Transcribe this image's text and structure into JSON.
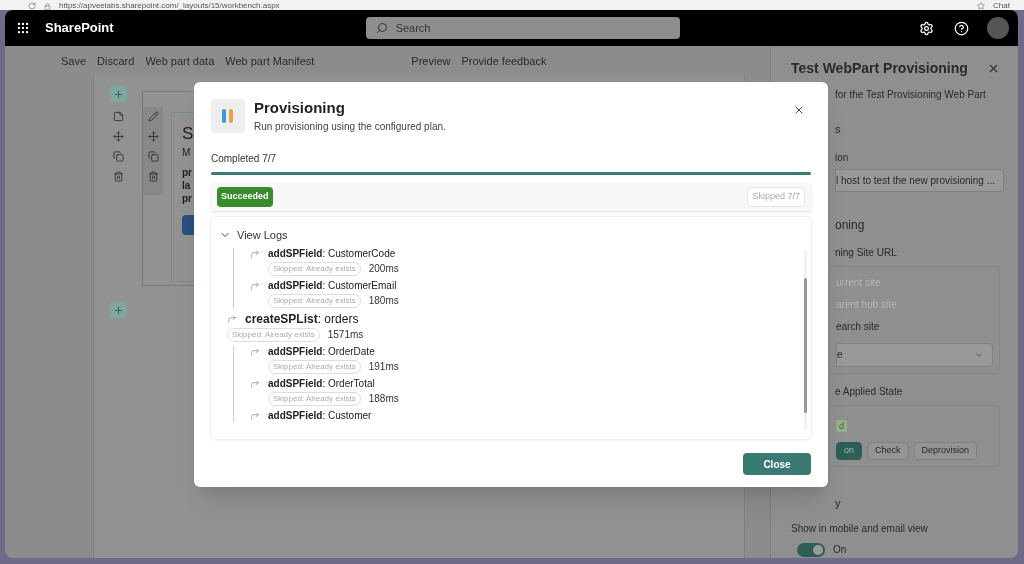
{
  "browser": {
    "url": "https://apveelabs.sharepoint.com/_layouts/15/workbench.aspx",
    "chat_label": "Chat"
  },
  "suite_bar": {
    "app_name": "SharePoint",
    "search_placeholder": "Search"
  },
  "command_bar": {
    "left": [
      "Save",
      "Discard",
      "Web part data",
      "Web part Manifest"
    ],
    "right": [
      "Preview",
      "Provide feedback"
    ]
  },
  "canvas": {
    "webpart_fragments": [
      "S",
      "M"
    ],
    "body_fragments": [
      "pr",
      "la",
      "pr"
    ]
  },
  "property_pane": {
    "title": "Test WebPart Provisioning",
    "description": "for the Test Provisioning Web Part",
    "group_1": "s",
    "field_label": "ion",
    "field_value": "l host to test the new provisioning ...",
    "group_2": "oning",
    "site_url_label": "ning Site URL",
    "site_options": [
      {
        "label": "urrent site",
        "disabled": true
      },
      {
        "label": "arent hub site",
        "disabled": true
      },
      {
        "label": "earch site",
        "disabled": false
      }
    ],
    "dropdown_value": "e",
    "state_label": "e Applied State",
    "state_badge": "d",
    "actions": [
      {
        "label": "on",
        "primary": true
      },
      {
        "label": "Check",
        "primary": false
      },
      {
        "label": "Deprovision",
        "primary": false
      }
    ],
    "group_3": "y",
    "toggle": {
      "label": "Show in mobile and email view",
      "on": true,
      "state_text": "On"
    }
  },
  "dialog": {
    "title": "Provisioning",
    "subtitle": "Run provisioning using the configured plan.",
    "progress_label": "Completed 7/7",
    "progress": {
      "level": 1
    },
    "result_badge": "Succeeded",
    "skipped_badge": "Skipped 7/7",
    "logs_header": "View Logs",
    "logs_expanded": true,
    "logs": [
      {
        "children": [
          {
            "text": "**addSPField**: CustomerCode",
            "status": "Skipped: Already exists",
            "duration": "200ms"
          },
          {
            "text": "**addSPField**: CustomerEmail",
            "status": "Skipped: Already exists",
            "duration": "180ms"
          }
        ]
      },
      {
        "text": "**createSPList**: orders",
        "status": "Skipped: Already exists",
        "duration": "1571ms",
        "children": [
          {
            "text": "**addSPField**: OrderDate",
            "status": "Skipped: Already exists",
            "duration": "191ms"
          },
          {
            "text": "**addSPField**: OrderTotal",
            "status": "Skipped: Already exists",
            "duration": "188ms"
          },
          {
            "text": "**addSPField**: Customer"
          }
        ]
      }
    ],
    "close_button": "Close"
  }
}
